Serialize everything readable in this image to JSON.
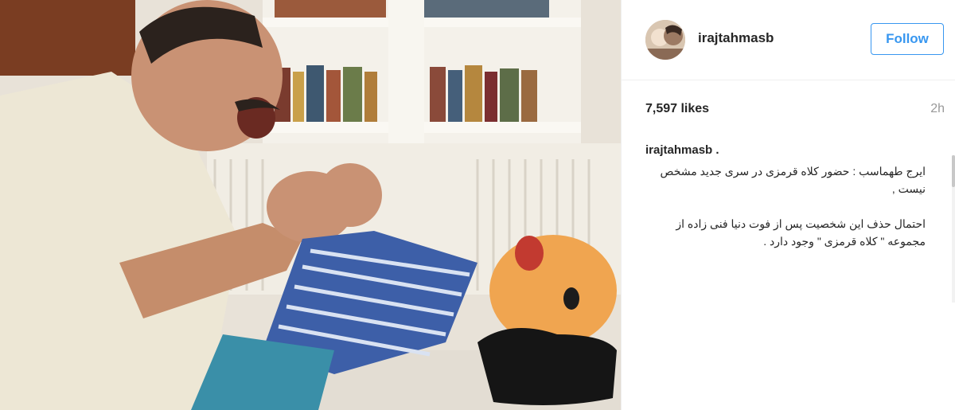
{
  "post": {
    "username": "irajtahmasb",
    "follow_label": "Follow",
    "likes": "7,597 likes",
    "time_ago": "2h",
    "caption_user": "irajtahmasb .",
    "caption_lines": [
      "ایرج طهماسب : حضور کلاه قرمزی در سری جدید مشخص نیست ,",
      "احتمال حذف این شخصیت پس از فوت دنیا فنی زاده از مجموعه \" کلاه قرمزی \" وجود دارد ."
    ]
  },
  "colors": {
    "accent": "#3897f0",
    "text": "#262626",
    "muted": "#999999"
  },
  "icons": {
    "avatar": "profile-photo"
  }
}
